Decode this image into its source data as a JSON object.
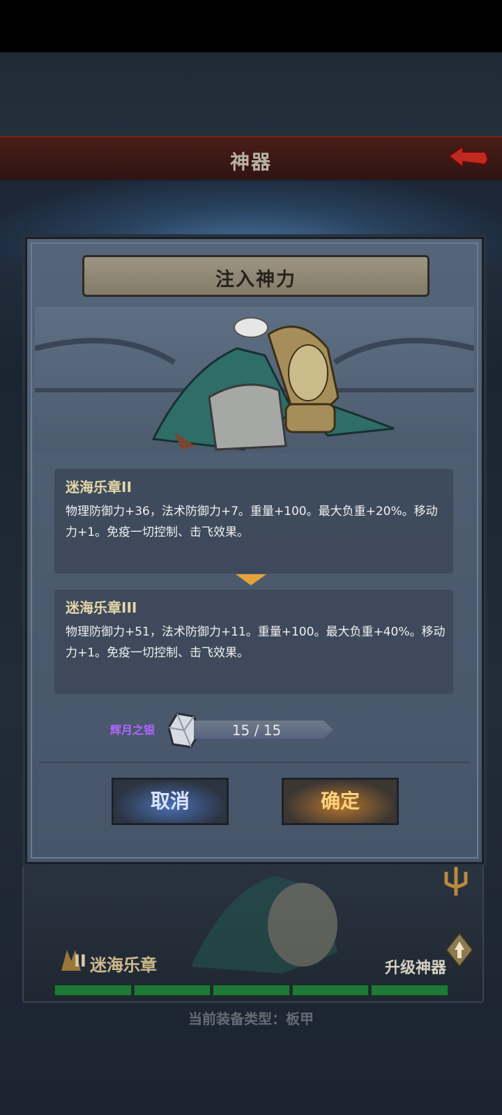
{
  "top_bar": {
    "title": "神器"
  },
  "dialog": {
    "title": "注入神力",
    "current": {
      "name": "迷海乐章II",
      "desc": "物理防御力+36，法术防御力+7。重量+100。最大负重+20%。移动力+1。免疫一切控制、击飞效果。"
    },
    "next": {
      "name": "迷海乐章III",
      "desc": "物理防御力+51，法术防御力+11。重量+100。最大负重+40%。移动力+1。免疫一切控制、击飞效果。"
    },
    "cost": {
      "label": "辉月之银",
      "count": "15 / 15"
    },
    "buttons": {
      "cancel": "取消",
      "confirm": "确定"
    }
  },
  "background_card": {
    "numeral": "II",
    "name": "迷海乐章",
    "upgrade_label": "升级神器",
    "progress_segments": 5
  },
  "equip_type": "当前装备类型：板甲",
  "icons": [
    "back-arrow-icon",
    "silver-ore-icon",
    "armor-artifact-icon",
    "trident-icon",
    "upgrade-icon"
  ],
  "colors": {
    "confirm_text": "#ffd27a",
    "cancel_text": "#dbe4ff",
    "cost_label": "#b066ff",
    "progress": "#1f7a37"
  }
}
